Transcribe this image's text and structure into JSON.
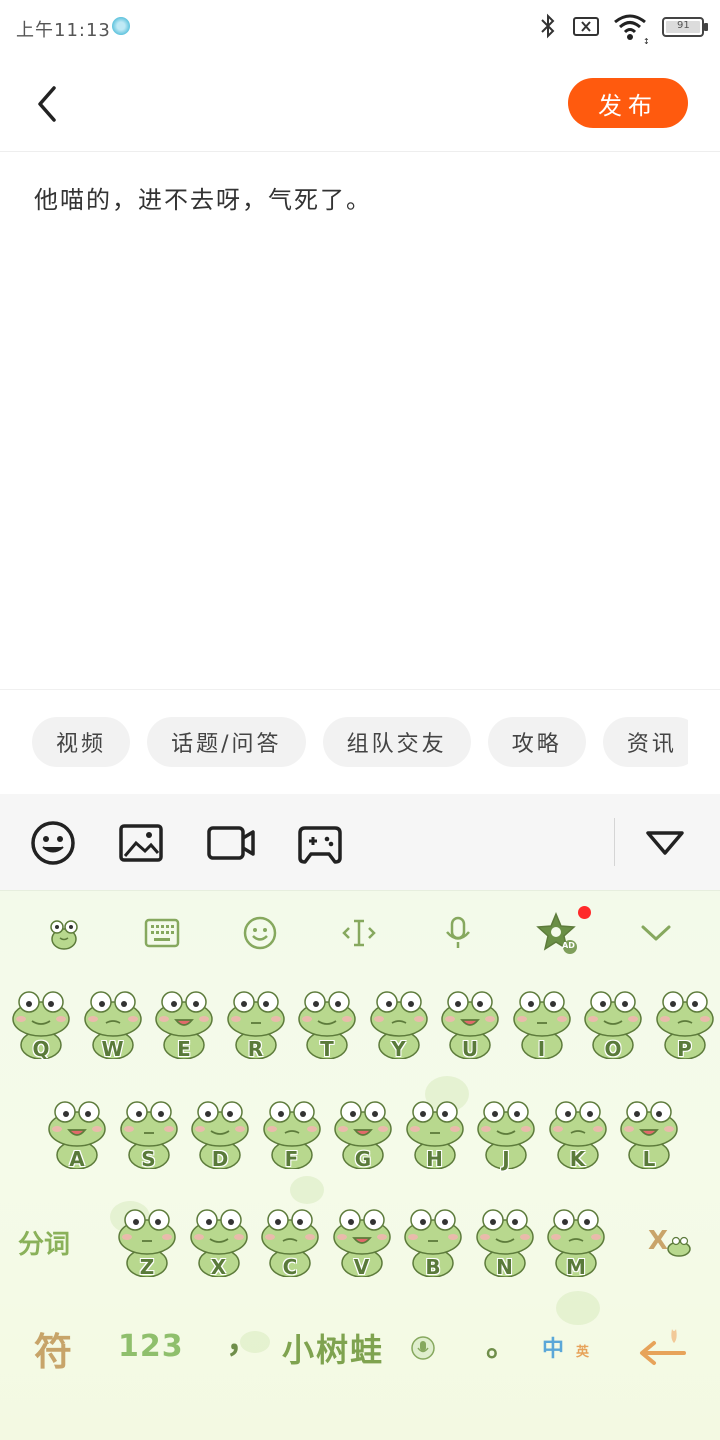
{
  "status_bar": {
    "time": "上午11:13",
    "battery": "91"
  },
  "header": {
    "publish_label": "发布"
  },
  "editor": {
    "text": "他喵的，进不去呀，气死了。"
  },
  "tags": [
    "视频",
    "话题/问答",
    "组队交友",
    "攻略",
    "资讯"
  ],
  "toolbar": {
    "icons": [
      "smiley-icon",
      "image-icon",
      "video-icon",
      "gamepad-icon",
      "collapse-icon"
    ]
  },
  "keyboard": {
    "theme_name": "小树蛙",
    "row1": [
      "Q",
      "W",
      "E",
      "R",
      "T",
      "Y",
      "U",
      "I",
      "O",
      "P"
    ],
    "row2": [
      "A",
      "S",
      "D",
      "F",
      "G",
      "H",
      "J",
      "K",
      "L"
    ],
    "row3": [
      "Z",
      "X",
      "C",
      "V",
      "B",
      "N",
      "M"
    ],
    "segment_label": "分词",
    "symbol_label": "符",
    "number_label": "123",
    "comma_label": "，",
    "period_label": "。",
    "lang_label": "中",
    "lang_sub_label": "英",
    "ad_label": "AD",
    "colors": {
      "frog_body": "#b8d88e",
      "frog_outline": "#5d7b3b",
      "accent": "#ff5a0e"
    }
  }
}
